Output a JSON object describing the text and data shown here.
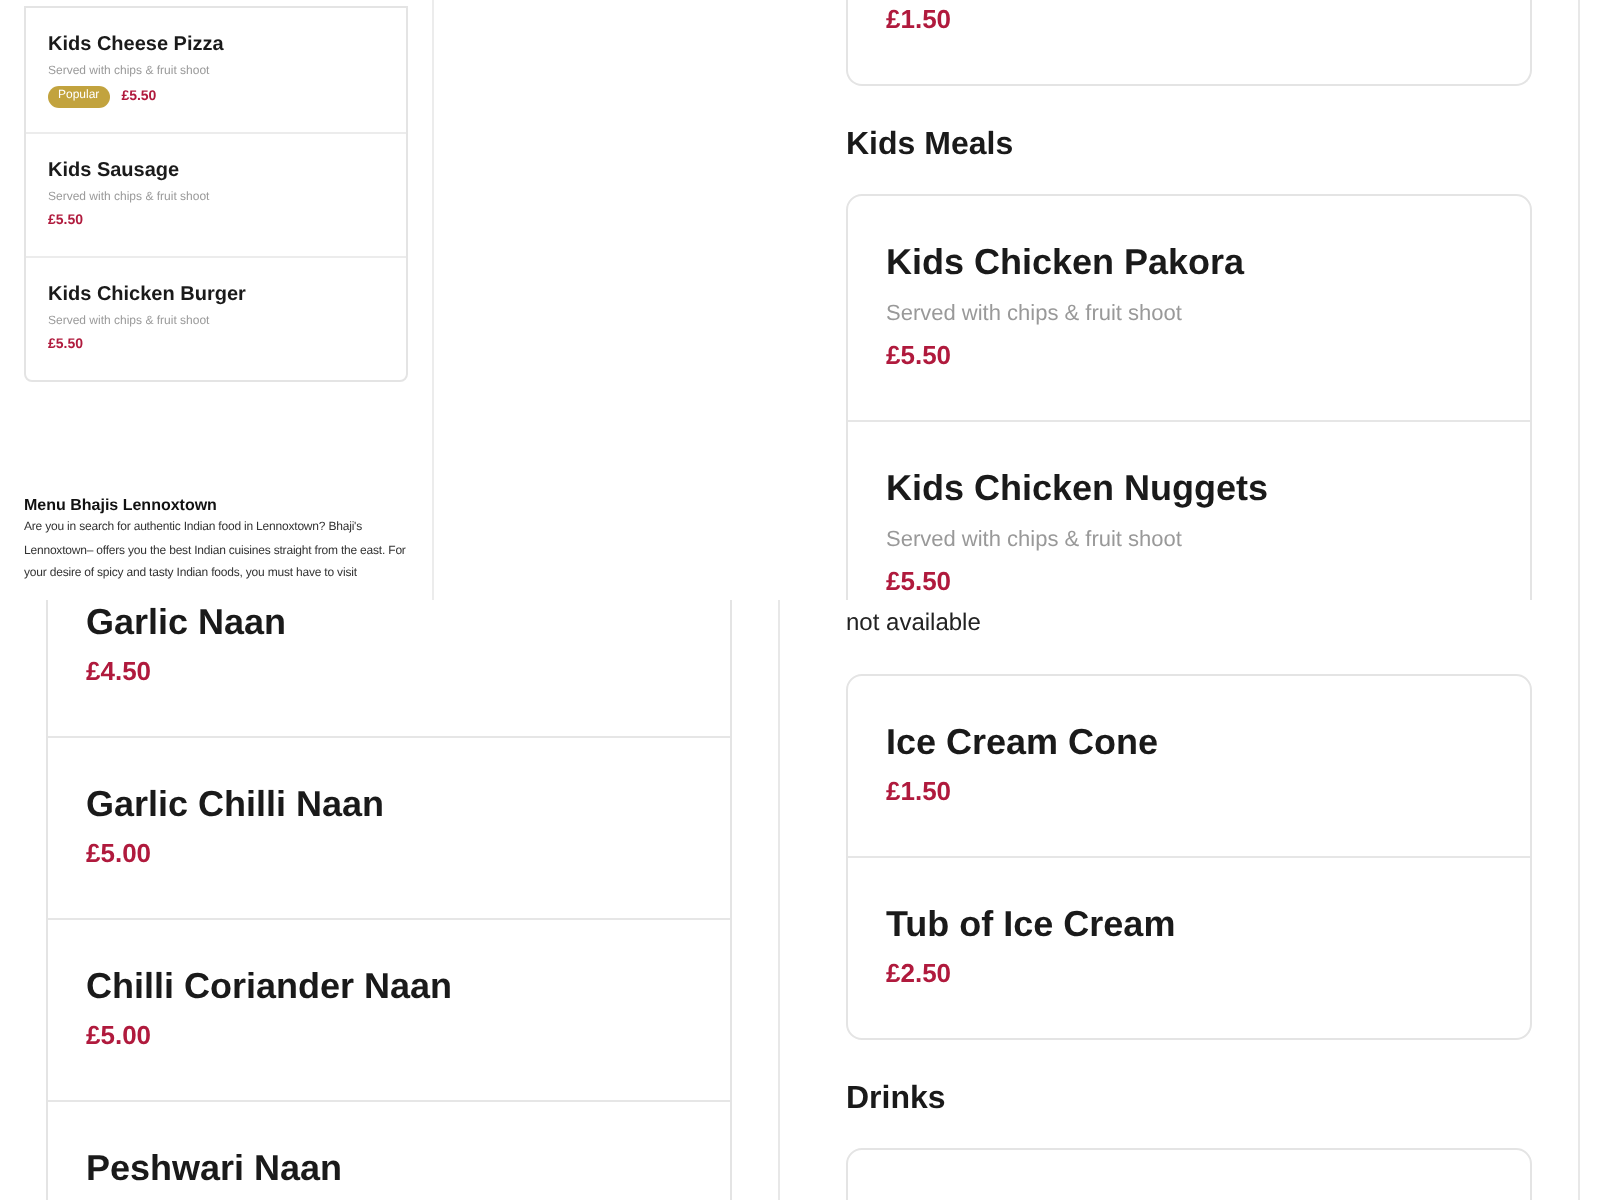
{
  "panels": [
    {
      "kind": "compact",
      "blocks": [
        {
          "kind": "card",
          "items": [
            {
              "name": "Kids Cheese Pizza",
              "description": "Served with chips & fruit shoot",
              "badge": "Popular",
              "price": "£5.50"
            },
            {
              "name": "Kids Sausage",
              "description": "Served with chips & fruit shoot",
              "price": "£5.50"
            },
            {
              "name": "Kids Chicken Burger",
              "description": "Served with chips & fruit shoot",
              "price": "£5.50"
            }
          ]
        },
        {
          "kind": "about",
          "title": "Menu Bhajis Lennoxtown",
          "text": "Are you in search for authentic Indian food in Lennoxtown? Bhaji's Lennoxtown– offers you the best Indian cuisines straight from the east. For your desire of spicy and tasty Indian foods, you must have to visit"
        }
      ]
    },
    {
      "kind": "wide",
      "blocks": [
        {
          "kind": "card",
          "items": [
            {
              "price": "£1.50"
            }
          ]
        },
        {
          "kind": "heading",
          "text": "Kids Meals"
        },
        {
          "kind": "card",
          "items": [
            {
              "name": "Kids Chicken Pakora",
              "description": "Served with chips & fruit shoot",
              "price": "£5.50"
            },
            {
              "name": "Kids Chicken Nuggets",
              "description": "Served with chips & fruit shoot",
              "price": "£5.50"
            }
          ]
        }
      ]
    },
    {
      "kind": "wide",
      "blocks": [
        {
          "kind": "card",
          "items": [
            {
              "name": "Garlic Naan",
              "price": "£4.50"
            },
            {
              "name": "Garlic Chilli Naan",
              "price": "£5.00"
            },
            {
              "name": "Chilli Coriander Naan",
              "price": "£5.00"
            },
            {
              "name": "Peshwari Naan"
            }
          ]
        }
      ]
    },
    {
      "kind": "wide",
      "blocks": [
        {
          "kind": "note",
          "text": "not available"
        },
        {
          "kind": "card",
          "items": [
            {
              "name": "Ice Cream Cone",
              "price": "£1.50"
            },
            {
              "name": "Tub of Ice Cream",
              "price": "£2.50"
            }
          ]
        },
        {
          "kind": "heading",
          "text": "Drinks"
        },
        {
          "kind": "card"
        }
      ]
    }
  ]
}
